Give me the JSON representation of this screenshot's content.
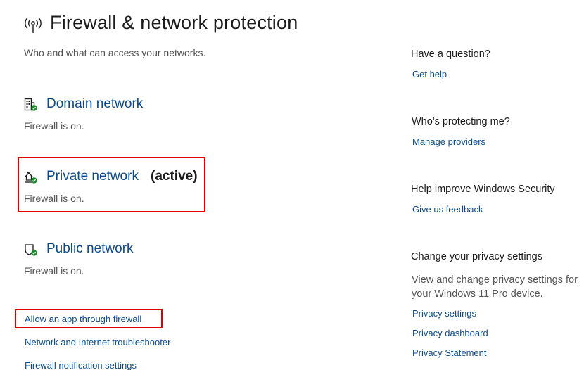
{
  "header": {
    "title": "Firewall & network protection",
    "subtitle": "Who and what can access your networks.",
    "icon": "broadcast-antenna-icon"
  },
  "networks": [
    {
      "name": "Domain network",
      "active_label": "",
      "status": "Firewall is on.",
      "icon": "domain-network-icon"
    },
    {
      "name": "Private network",
      "active_label": "(active)",
      "status": "Firewall is on.",
      "icon": "private-network-icon"
    },
    {
      "name": "Public network",
      "active_label": "",
      "status": "Firewall is on.",
      "icon": "public-network-icon"
    }
  ],
  "links": {
    "allow_app": "Allow an app through firewall",
    "troubleshooter": "Network and Internet troubleshooter",
    "notifications": "Firewall notification settings"
  },
  "sidebar": {
    "question": {
      "heading": "Have a question?",
      "link": "Get help"
    },
    "protecting": {
      "heading": "Who's protecting me?",
      "link": "Manage providers"
    },
    "improve": {
      "heading": "Help improve Windows Security",
      "link": "Give us feedback"
    },
    "privacy": {
      "heading": "Change your privacy settings",
      "description": "View and change privacy settings for your Windows 11 Pro device.",
      "links": [
        "Privacy settings",
        "Privacy dashboard",
        "Privacy Statement"
      ]
    }
  },
  "colors": {
    "link": "#0a4b8f",
    "highlight": "#e00000",
    "status_ok": "#1a8a2a"
  }
}
